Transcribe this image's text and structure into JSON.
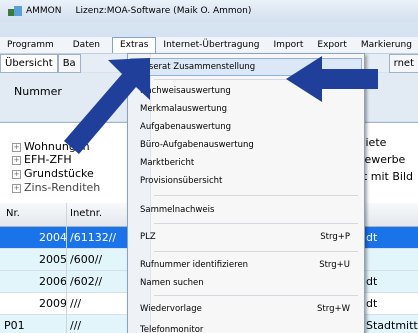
{
  "window": {
    "app_name": "AMMON",
    "title": "Lizenz:MOA-Software (Maik O. Ammon)"
  },
  "menubar": {
    "items": [
      "Programm",
      "Daten",
      "Extras",
      "Internet-Übertragung",
      "Import",
      "Export",
      "Markierung"
    ],
    "open_item": "Extras"
  },
  "tabs": {
    "first": "Übersicht",
    "second": "Ba",
    "right": "rnet"
  },
  "toolband": {
    "number_label": "Nummer"
  },
  "tree": {
    "items": [
      "Wohnungen",
      "EFH-ZFH",
      "Grundstücke",
      "Zins-Renditeh"
    ],
    "right_items": [
      "e",
      "Miete",
      "Gewerbe",
      "nt mit Bild"
    ]
  },
  "grid": {
    "headers": {
      "nr": "Nr.",
      "inetnr": "Inetnr."
    },
    "rows": [
      {
        "nr": "2004",
        "inet": "/61132//",
        "right": "dt"
      },
      {
        "nr": "2005",
        "inet": "/600//",
        "right": ""
      },
      {
        "nr": "2006",
        "inet": "/602//",
        "right": "dt"
      },
      {
        "nr": "2009",
        "inet": "///",
        "right": "dt"
      },
      {
        "nr": "P01",
        "inet": "///",
        "right": "Stadtmitte"
      }
    ]
  },
  "extras_menu": {
    "items": [
      {
        "label": "Inserat Zusammenstellung",
        "shortcut": ""
      },
      {
        "label": "Nachweisauswertung",
        "shortcut": ""
      },
      {
        "label": "Merkmalauswertung",
        "shortcut": ""
      },
      {
        "label": "Aufgabenauswertung",
        "shortcut": ""
      },
      {
        "label": "Büro-Aufgabenauswertung",
        "shortcut": ""
      },
      {
        "label": "Marktbericht",
        "shortcut": ""
      },
      {
        "label": "Provisionsübersicht",
        "shortcut": ""
      },
      {
        "label": "Sammelnachweis",
        "shortcut": ""
      },
      {
        "label": "PLZ",
        "shortcut": "Strg+P"
      },
      {
        "label": "Rufnummer identifizieren",
        "shortcut": "Strg+U"
      },
      {
        "label": "Namen suchen",
        "shortcut": ""
      },
      {
        "label": "Wiedervorlage",
        "shortcut": "Strg+W"
      },
      {
        "label": "Telefonmonitor",
        "shortcut": ""
      }
    ]
  },
  "colors": {
    "selection": "#1a73e8",
    "alt_row": "#e2f5fa",
    "arrow": "#1f3f9a",
    "menu_highlight": "#dde8f6"
  }
}
